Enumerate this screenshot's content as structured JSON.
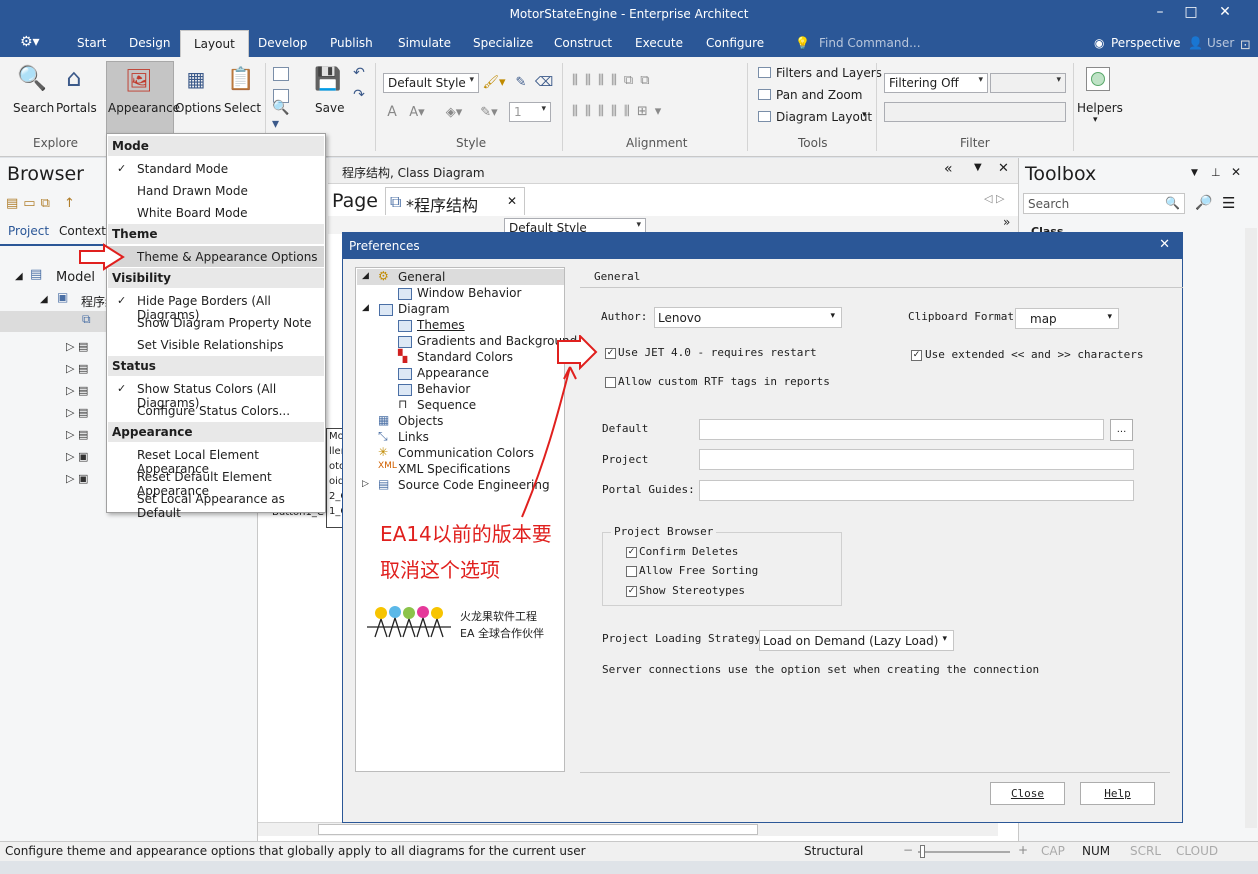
{
  "window": {
    "title": "MotorStateEngine - Enterprise Architect"
  },
  "menu": {
    "tabs": [
      "Start",
      "Design",
      "Layout",
      "Develop",
      "Publish",
      "Simulate",
      "Specialize",
      "Construct",
      "Execute",
      "Configure"
    ],
    "find_command": "Find Command...",
    "perspective": "Perspective",
    "user": "User"
  },
  "ribbon": {
    "search": "Search",
    "portals": "Portals",
    "appearance": "Appearance",
    "options": "Options",
    "select": "Select",
    "save": "Save",
    "explore_group": "Explore",
    "style_group": "Style",
    "alignment_group": "Alignment",
    "tools_group": "Tools",
    "filter_group": "Filter",
    "style_combo": "Default Style",
    "line_width": "1",
    "filters_and_layers": "Filters and Layers",
    "pan_and_zoom": "Pan and Zoom",
    "diagram_layout": "Diagram Layout",
    "filtering": "Filtering Off",
    "helpers": "Helpers"
  },
  "dropdown": {
    "mode_header": "Mode",
    "mode_items": [
      "Standard Mode",
      "Hand Drawn Mode",
      "White Board Mode"
    ],
    "theme_header": "Theme",
    "theme_item": "Theme & Appearance Options",
    "visibility_header": "Visibility",
    "visibility_items": [
      "Hide Page Borders (All Diagrams)",
      "Show Diagram Property Note",
      "Set Visible Relationships"
    ],
    "status_header": "Status",
    "status_items": [
      "Show Status Colors (All Diagrams)",
      "Configure Status Colors..."
    ],
    "appearance_header": "Appearance",
    "appearance_items": [
      "Reset Local Element Appearance",
      "Reset Default Element Appearance",
      "Set Local Appearance as Default"
    ]
  },
  "browser": {
    "title": "Browser",
    "tab_project": "Project",
    "tab_context": "Context",
    "model": "Model",
    "package": "程序结构"
  },
  "diagram": {
    "header": "程序结构, Class Diagram",
    "page_tab": "Page",
    "diagram_tab": "*程序结构",
    "style_combo": "Default Style",
    "fragments": [
      "Mo",
      "ller",
      "oto",
      "oid",
      "2_C",
      "1_C",
      "Button1_C"
    ]
  },
  "toolbox": {
    "title": "Toolbox",
    "search_placeholder": "Search",
    "section": "Class"
  },
  "dialog": {
    "title": "Preferences",
    "tree": [
      "General",
      "Window Behavior",
      "Diagram",
      "Themes",
      "Gradients and Background",
      "Standard Colors",
      "Appearance",
      "Behavior",
      "Sequence",
      "Objects",
      "Links",
      "Communication Colors",
      "XML Specifications",
      "Source Code Engineering"
    ],
    "section_title": "General",
    "author_label": "Author:",
    "author_value": "Lenovo",
    "clipboard_label": "Clipboard Format:",
    "clipboard_value": "map",
    "use_jet": "Use JET 4.0 - requires restart",
    "allow_rtf": "Allow custom RTF tags in reports",
    "use_extended": "Use extended << and >> characters",
    "default_dir_label": "Default",
    "project_dir_label": "Project",
    "portal_guides_label": "Portal Guides:",
    "browse_btn": "...",
    "project_browser_label": "Project Browser",
    "confirm_deletes": "Confirm Deletes",
    "allow_free_sorting": "Allow Free Sorting",
    "show_stereotypes": "Show Stereotypes",
    "loading_label": "Project Loading Strategy:",
    "loading_value": "Load on Demand (Lazy Load)",
    "server_note": "Server connections use the option set when creating the connection",
    "close_btn": "Close",
    "help_btn": "Help"
  },
  "annotation": {
    "line1": "EA14以前的版本要",
    "line2": "取消这个选项",
    "logo_line1": "火龙果软件工程",
    "logo_line2": "EA 全球合作伙伴"
  },
  "status": {
    "message": "Configure theme and appearance options that globally apply to all diagrams for the current user",
    "mode": "Structural",
    "cap": "CAP",
    "num": "NUM",
    "scrl": "SCRL",
    "cloud": "CLOUD"
  }
}
